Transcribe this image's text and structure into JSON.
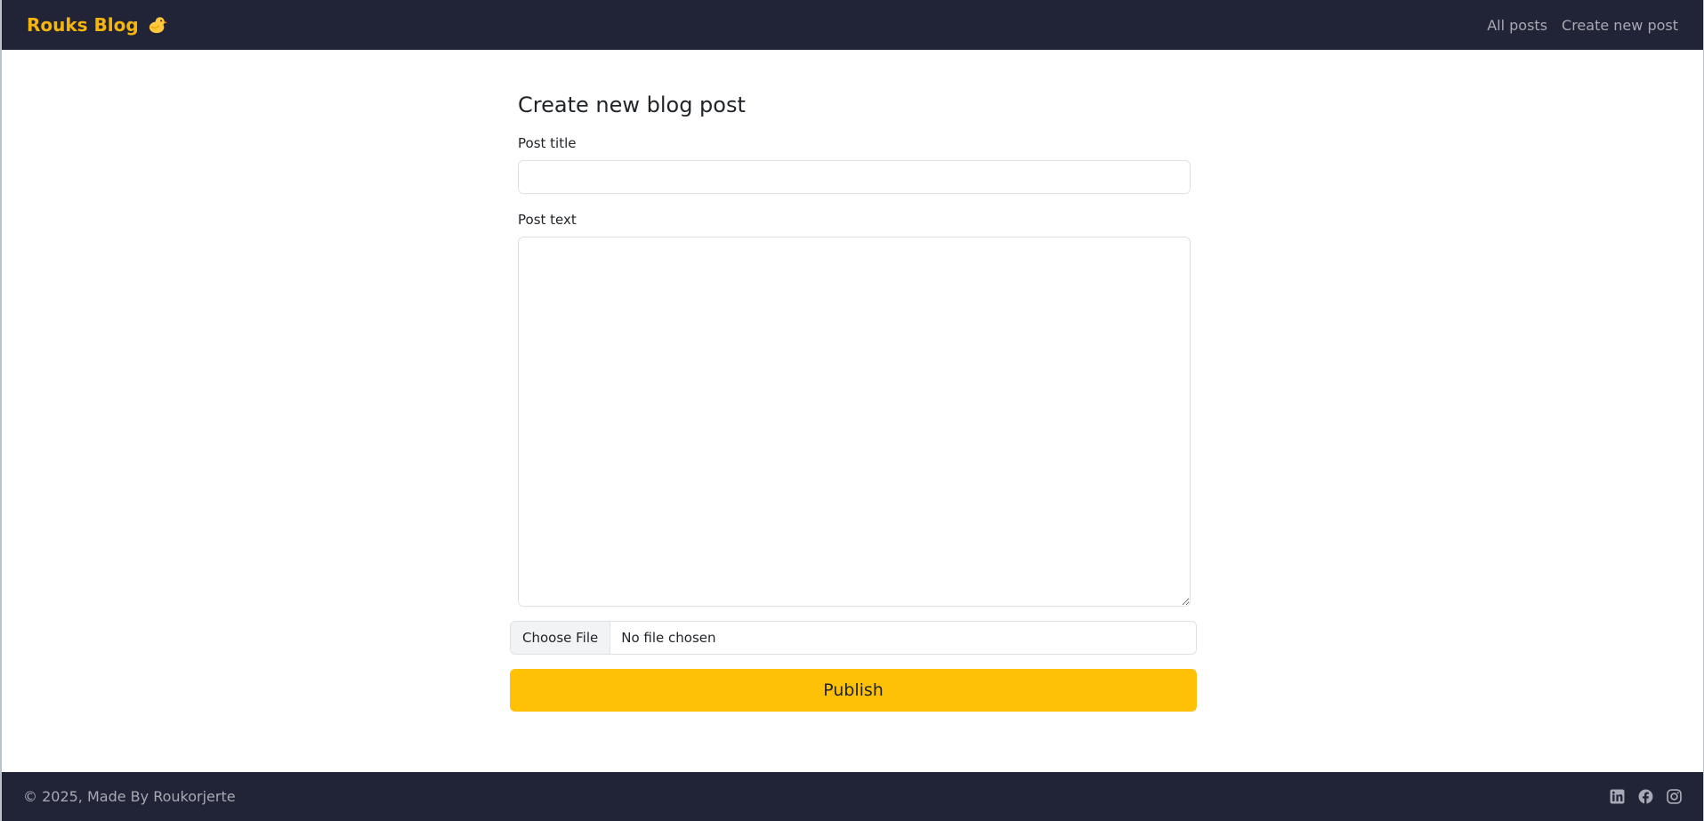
{
  "navbar": {
    "brand": "Rouks Blog",
    "brand_color": "#f5b50c",
    "background": "#212336",
    "links": [
      {
        "label": "All posts"
      },
      {
        "label": "Create new post"
      }
    ]
  },
  "form": {
    "heading": "Create new blog post",
    "title_label": "Post title",
    "title_value": "",
    "text_label": "Post text",
    "text_value": "",
    "file_button": "Choose File",
    "file_status": "No file chosen",
    "publish_label": "Publish",
    "publish_color": "#ffc107"
  },
  "footer": {
    "copyright": "© 2025, Made By Roukorjerte",
    "social_icons": [
      "linkedin-icon",
      "facebook-icon",
      "instagram-icon"
    ]
  }
}
